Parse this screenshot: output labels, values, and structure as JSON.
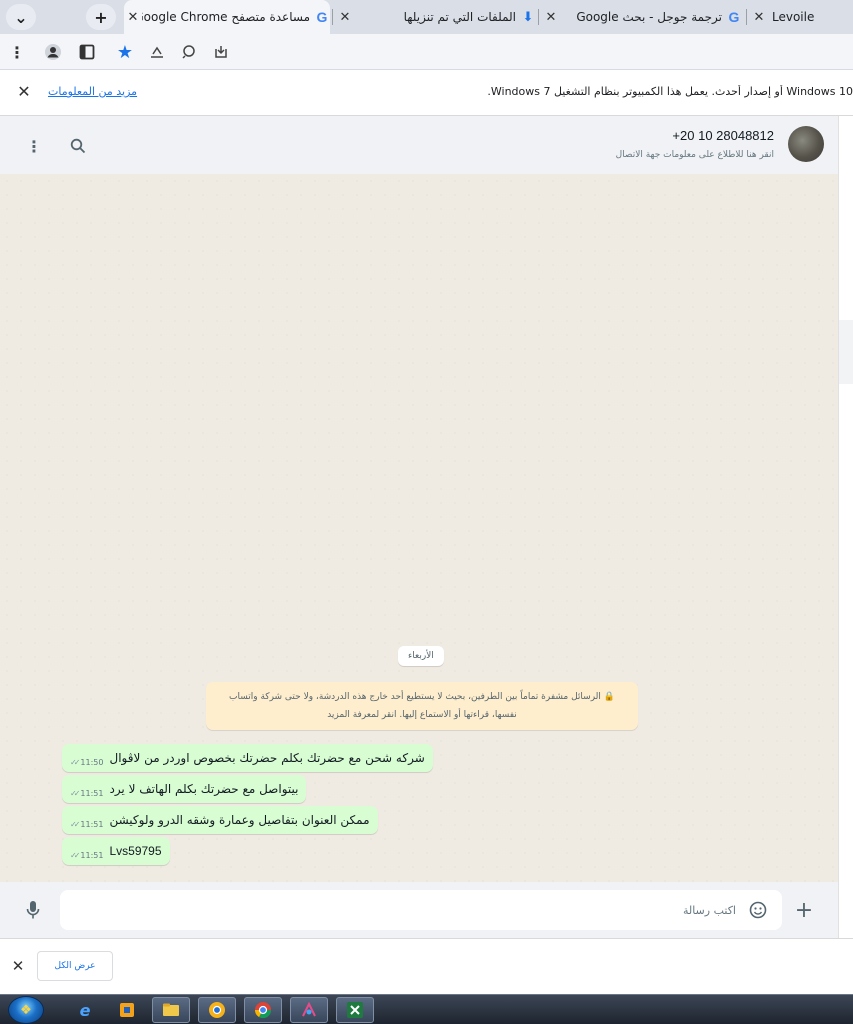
{
  "browser": {
    "tabs": [
      {
        "title": "Levoile",
        "icon": ""
      },
      {
        "title": "ترجمة جوجل - بحث Google",
        "icon": "G"
      },
      {
        "title": "الملفات التي تم تنزيلها",
        "icon": "download"
      },
      {
        "title": "مساعدة متصفح Google Chrome",
        "icon": "G"
      }
    ],
    "new_tab_symbol": "+",
    "tab_search_symbol": "⌄",
    "close_symbol": "✕"
  },
  "infobar": {
    "message": "Windows 10 أو إصدار أحدث. يعمل هذا الكمبيوتر بنظام التشغيل Windows 7.",
    "message_left": "Windows 7.",
    "link": "مزيد من المعلومات",
    "close_symbol": "✕"
  },
  "chat": {
    "contact_phone": "+20 10 28048812",
    "contact_subtitle": "انقر هنا للاطلاع على معلومات جهة الاتصال",
    "date_separator": "الأربعاء",
    "encryption_notice": "الرسائل مشفرة تماماً بين الطرفين، بحيث لا يستطيع أحد خارج هذه الدردشة، ولا حتى شركة واتساب نفسها، قراءتها أو الاستماع إليها. انقر لمعرفة المزيد",
    "messages": [
      {
        "text": "شركه شحن مع حضرتك بكلم حضرتك بخصوص اوردر من لاڤوال",
        "time": "11:50",
        "ticks": "✓✓"
      },
      {
        "text": "بيتواصل مع حضرتك بكلم الهاتف لا يرد",
        "time": "11:51",
        "ticks": "✓✓"
      },
      {
        "text": "ممكن العنوان بتفاصيل وعمارة وشقه الدرو ولوكيشن",
        "time": "11:51",
        "ticks": "✓✓"
      },
      {
        "text": "Lvs59795",
        "time": "11:51",
        "ticks": "✓✓"
      }
    ],
    "input_placeholder": "اكتب رسالة"
  },
  "downloads": {
    "show_all": "عرض الكل",
    "close_symbol": "✕"
  },
  "taskbar": {
    "apps": [
      "ie-icon",
      "media-icon",
      "explorer-icon",
      "chrome-canary-icon",
      "chrome-icon",
      "app-icon",
      "excel-icon"
    ]
  },
  "colors": {
    "outgoing_bubble": "#d9fdd3",
    "chat_background": "#efeae2",
    "header_background": "#f0f2f5",
    "notice_background": "#ffeecd",
    "link_blue": "#1a73e8"
  }
}
